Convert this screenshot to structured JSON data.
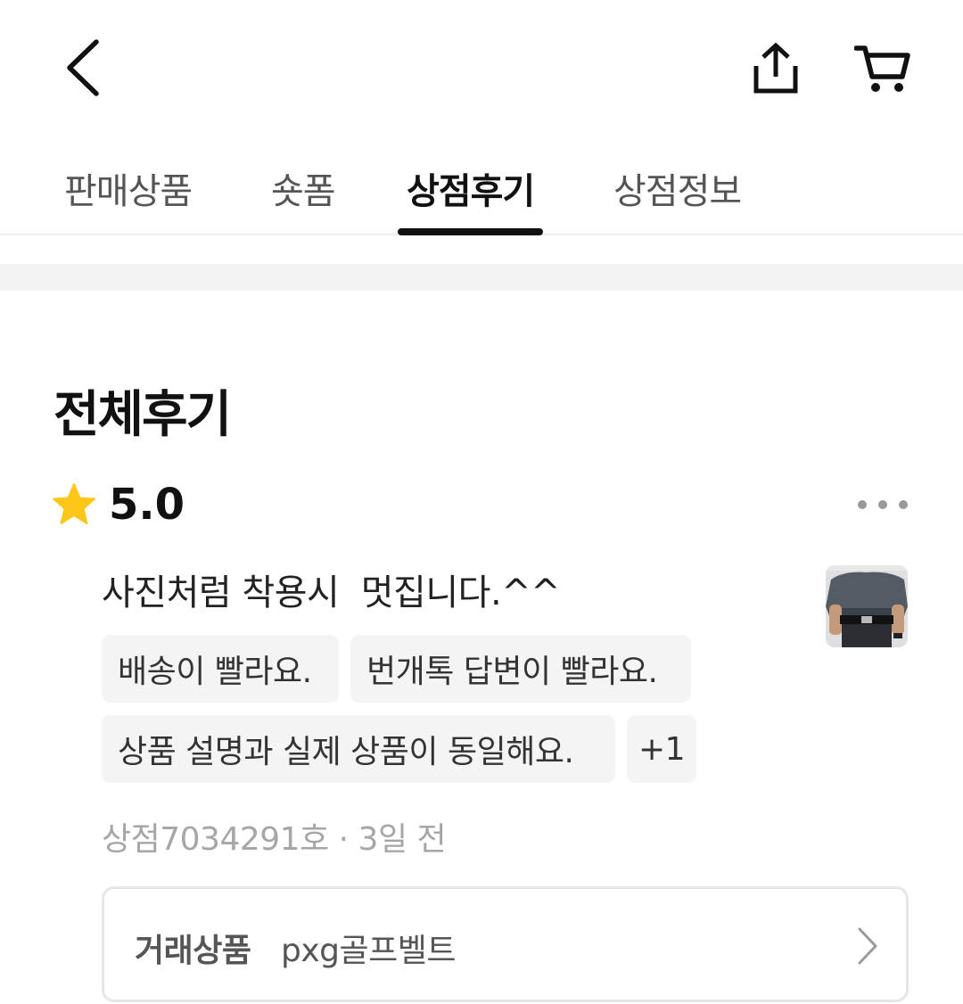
{
  "header": {
    "back_icon": "chevron-left-icon",
    "share_icon": "share-icon",
    "cart_icon": "cart-icon"
  },
  "tabs": [
    {
      "label": "판매상품"
    },
    {
      "label": "숏폼"
    },
    {
      "label": "상점후기",
      "active": true
    },
    {
      "label": "상점정보"
    }
  ],
  "reviews": {
    "title": "전체후기",
    "item": {
      "rating": "5.0",
      "rating_icon": "star-icon",
      "rating_color": "#FFC61A",
      "text": "사진처럼 착용시  멋집니다.^^",
      "tags": [
        "배송이 빨라요.",
        "번개톡 답변이 빨라요.",
        "상품 설명과 실제 상품이 동일해요.",
        "+1"
      ],
      "store": "상점7034291호",
      "separator": " · ",
      "time": "3일 전",
      "product_label": "거래상품",
      "product_name": "pxg골프벨트"
    }
  }
}
